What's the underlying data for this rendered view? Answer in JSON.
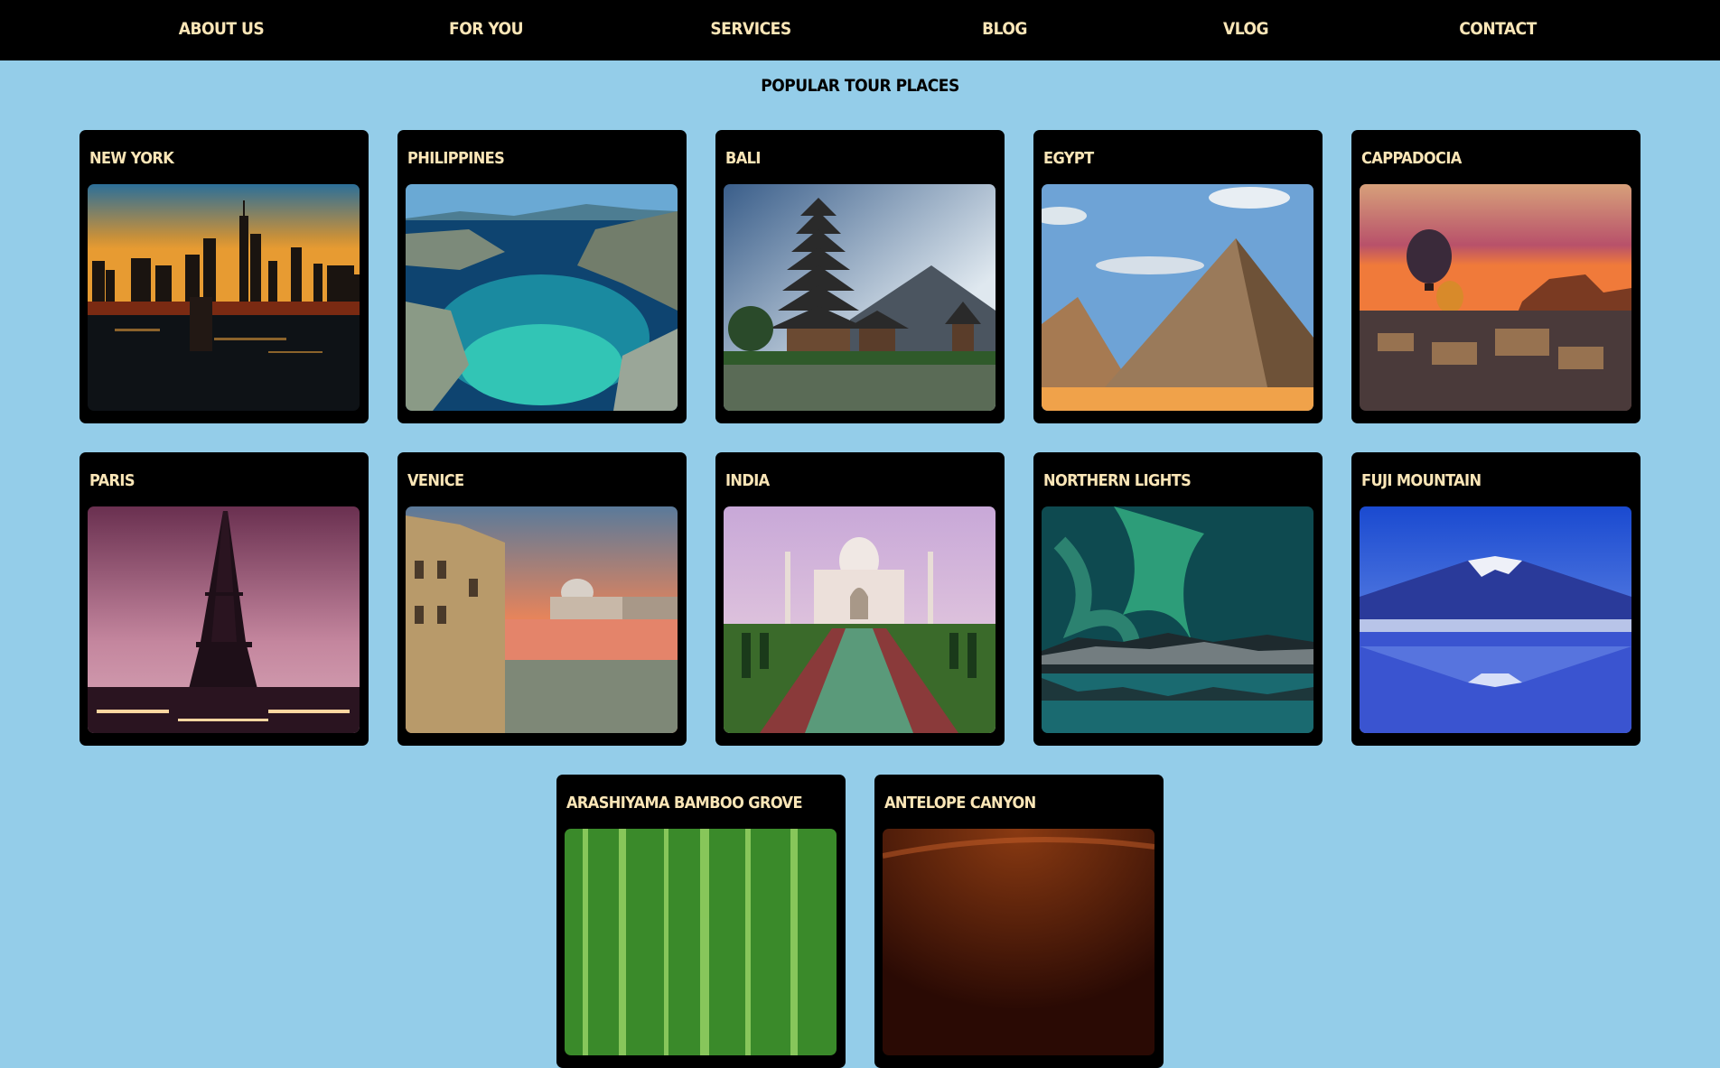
{
  "nav": {
    "items": [
      "ABOUT US",
      "FOR YOU",
      "SERVICES",
      "BLOG",
      "VLOG",
      "CONTACT"
    ]
  },
  "section": {
    "title": "POPULAR TOUR PLACES"
  },
  "cards": [
    {
      "title": "NEW YORK",
      "image": "new-york-skyline"
    },
    {
      "title": "PHILIPPINES",
      "image": "philippines-lagoon"
    },
    {
      "title": "BALI",
      "image": "bali-temple"
    },
    {
      "title": "EGYPT",
      "image": "egypt-pyramids"
    },
    {
      "title": "CAPPADOCIA",
      "image": "cappadocia-balloons"
    },
    {
      "title": "PARIS",
      "image": "paris-eiffel-tower"
    },
    {
      "title": "VENICE",
      "image": "venice-canal"
    },
    {
      "title": "INDIA",
      "image": "taj-mahal"
    },
    {
      "title": "NORTHERN LIGHTS",
      "image": "aurora"
    },
    {
      "title": "FUJI MOUNTAIN",
      "image": "mount-fuji"
    },
    {
      "title": "ARASHIYAMA BAMBOO GROVE",
      "image": "bamboo-grove"
    },
    {
      "title": "ANTELOPE CANYON",
      "image": "antelope-canyon"
    }
  ],
  "colors": {
    "background": "#94cde9",
    "navbar": "#000000",
    "accent_text": "#fbe6b7",
    "card": "#000000"
  }
}
